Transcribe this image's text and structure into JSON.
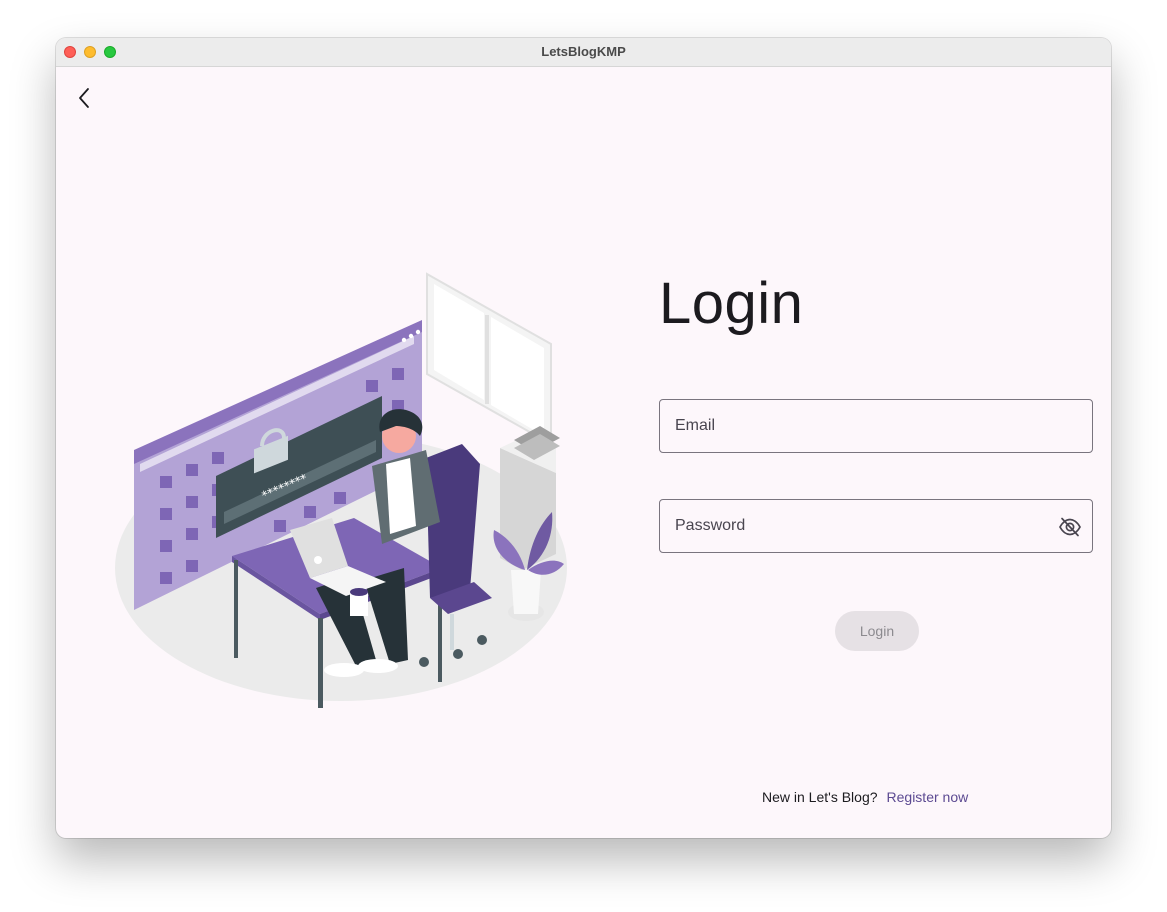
{
  "window": {
    "title": "LetsBlogKMP"
  },
  "page": {
    "title": "Login"
  },
  "form": {
    "email": {
      "placeholder": "Email",
      "value": ""
    },
    "password": {
      "placeholder": "Password",
      "value": ""
    },
    "login_label": "Login"
  },
  "register": {
    "prompt": "New in Let's Blog?",
    "link_label": "Register now"
  },
  "icons": {
    "back": "chevron-left-icon",
    "visibility": "eye-off-icon"
  },
  "colors": {
    "accent": "#5c4a92",
    "illustration_purple": "#8b73bd",
    "background": "#fdf7fb",
    "disabled_button": "#e6e1e5"
  }
}
